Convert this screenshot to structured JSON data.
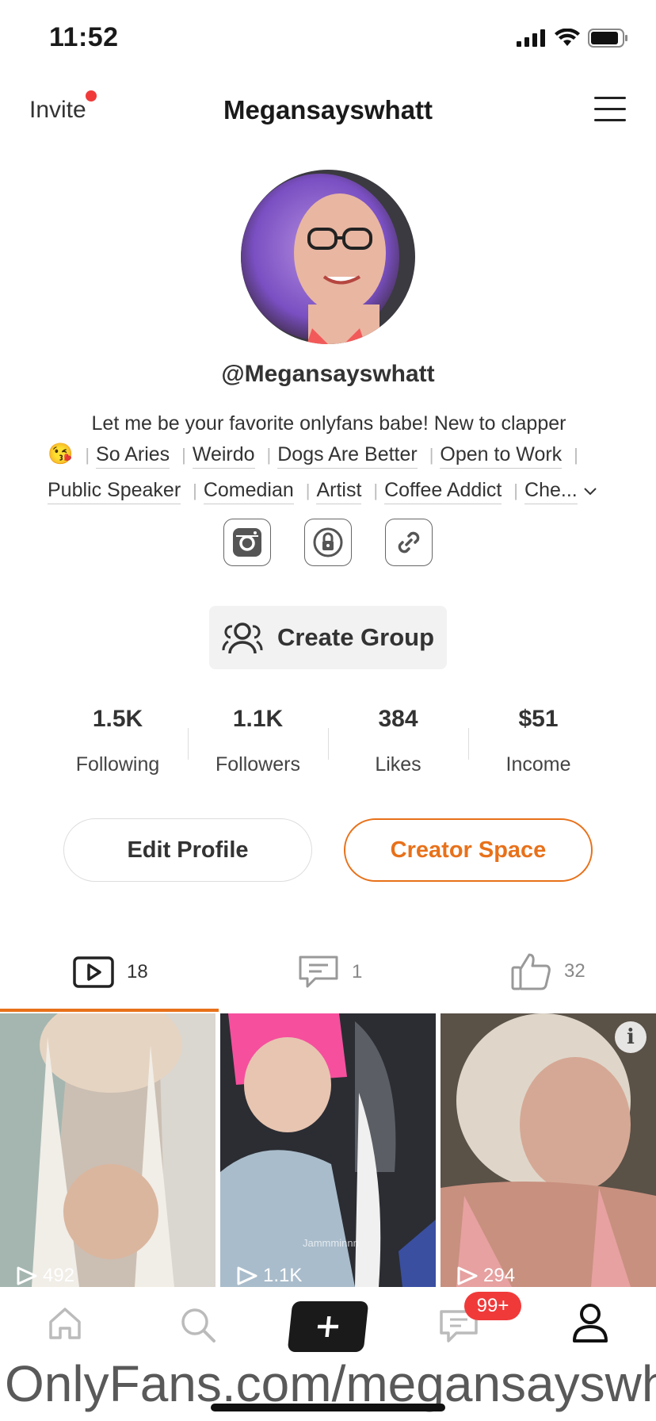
{
  "status_bar": {
    "time": "11:52"
  },
  "header": {
    "invite_label": "Invite",
    "title": "Megansayswhatt"
  },
  "profile": {
    "handle": "@Megansayswhatt",
    "bio": "Let me be your favorite onlyfans babe! New to clapper",
    "emoji": "😘",
    "tags_row1": [
      "So Aries",
      "Weirdo",
      "Dogs Are Better",
      "Open to Work"
    ],
    "tags_row2": [
      "Public Speaker",
      "Comedian",
      "Artist",
      "Coffee Addict",
      "Che..."
    ]
  },
  "create_group_label": "Create Group",
  "stats": [
    {
      "value": "1.5K",
      "label": "Following"
    },
    {
      "value": "1.1K",
      "label": "Followers"
    },
    {
      "value": "384",
      "label": "Likes"
    },
    {
      "value": "$51",
      "label": "Income"
    }
  ],
  "buttons": {
    "edit": "Edit Profile",
    "creator": "Creator Space"
  },
  "tabs": {
    "videos": "18",
    "comments": "1",
    "likes": "32"
  },
  "videos": [
    {
      "views": "492"
    },
    {
      "views": "1.1K",
      "caption": "Jammminnn"
    },
    {
      "views": "294"
    }
  ],
  "nav": {
    "badge": "99+"
  },
  "watermark": "OnlyFans.com/megansayswhatt",
  "colors": {
    "accent": "#e8711a",
    "badge": "#f03a3a"
  }
}
